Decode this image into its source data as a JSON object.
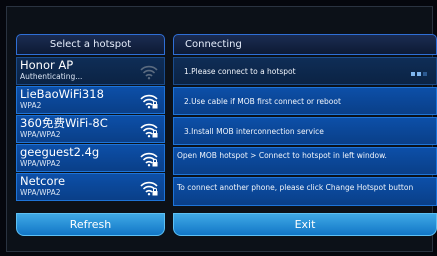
{
  "left_panel": {
    "title": "Select a hotspot",
    "hotspots": [
      {
        "name": "Honor AP",
        "security": "Authenticating...",
        "icon": "wifi-icon"
      },
      {
        "name": "LieBaoWiFi318",
        "security": "WPA2",
        "icon": "wifi-lock-icon"
      },
      {
        "name": "360免费WiFi-8C",
        "security": "WPA/WPA2",
        "icon": "wifi-lock-icon"
      },
      {
        "name": "geeguest2.4g",
        "security": "WPA/WPA2",
        "icon": "wifi-lock-icon"
      },
      {
        "name": "Netcore",
        "security": "WPA/WPA2",
        "icon": "wifi-lock-icon"
      }
    ],
    "refresh_label": "Refresh"
  },
  "right_panel": {
    "title": "Connecting",
    "steps": [
      "1.Please connect to a hotspot",
      "2.Use cable if MOB first connect or reboot",
      "3.Install MOB interconnection service"
    ],
    "info": [
      "Open MOB hotspot > Connect to hotspot in left window.",
      "To connect another phone, please click Change Hotspot button"
    ],
    "exit_label": "Exit"
  },
  "colors": {
    "background": "#05070d",
    "panel_blue": "#0c4fa8",
    "button_blue": "#1f8fd8",
    "border_blue": "#1e74d8"
  }
}
